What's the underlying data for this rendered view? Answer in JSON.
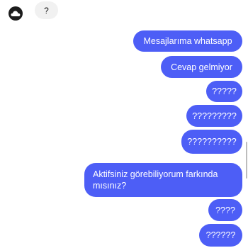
{
  "thread": {
    "incoming_message": "?",
    "outgoing_messages": [
      "Mesajlarıma whatsapp",
      "Cevap gelmiyor",
      "?????",
      "?????????",
      "??????????",
      "Aktifsiniz görebiliyorum farkında mısınız?",
      "????",
      "??????"
    ]
  },
  "colors": {
    "outgoing_bubble": "#4d5ef6",
    "incoming_bubble": "#f1f1f1",
    "avatar": "#1c1c1c"
  },
  "icons": {
    "avatar": "profile-avatar"
  }
}
